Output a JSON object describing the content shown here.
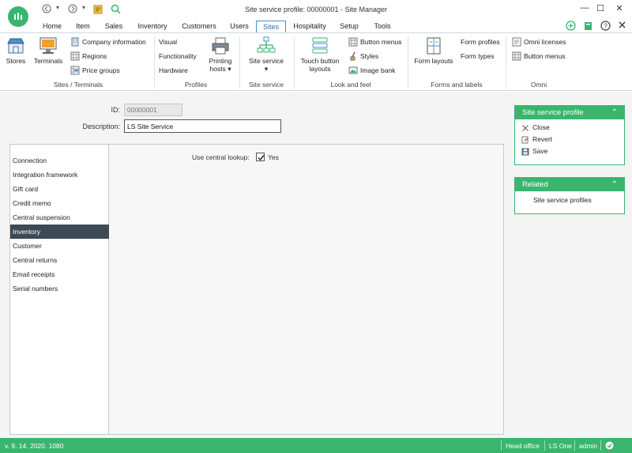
{
  "window": {
    "title": "Site service profile: 00000001 - Site Manager",
    "minimize": "—",
    "maximize": "☐",
    "close": "✕"
  },
  "quick_access": {
    "back": "◀",
    "dropdown": "▾",
    "forward": "▶",
    "dropdown2": "▾"
  },
  "tabs": [
    {
      "label": "Home"
    },
    {
      "label": "Item"
    },
    {
      "label": "Sales"
    },
    {
      "label": "Inventory"
    },
    {
      "label": "Customers"
    },
    {
      "label": "Users"
    },
    {
      "label": "Sites"
    },
    {
      "label": "Hospitality"
    },
    {
      "label": "Setup"
    },
    {
      "label": "Tools"
    }
  ],
  "active_tab": "Sites",
  "ribbon": {
    "sites_terminals": {
      "label": "Sites / Terminals",
      "stores": "Stores",
      "terminals": "Terminals",
      "company_information": "Company information",
      "regions": "Regions",
      "price_groups": "Price groups"
    },
    "profiles": {
      "label": "Profiles",
      "visual": "Visual",
      "functionality": "Functionality",
      "hardware": "Hardware",
      "printing_hosts_line1": "Printing",
      "printing_hosts_line2": "hosts",
      "dropdown": "▾"
    },
    "site_service": {
      "label": "Site service",
      "button": "Site service",
      "dropdown": "▾"
    },
    "look_and_feel": {
      "label": "Look and feel",
      "touch_line1": "Touch button",
      "touch_line2": "layouts",
      "button_menus": "Button menus",
      "styles": "Styles",
      "image_bank": "Image bank"
    },
    "forms_and_labels": {
      "label": "Forms and labels",
      "form_layouts": "Form layouts",
      "form_profiles": "Form profiles",
      "form_types": "Form types"
    },
    "omni": {
      "label": "Omni",
      "omni_licenses": "Omni licenses",
      "button_menus": "Button menus"
    }
  },
  "form": {
    "id_label": "ID:",
    "id_value": "00000001",
    "description_label": "Description:",
    "description_value": "LS Site Service"
  },
  "nav": {
    "items": [
      {
        "label": "Connection"
      },
      {
        "label": "Integration framework"
      },
      {
        "label": "Gift card"
      },
      {
        "label": "Credit  memo"
      },
      {
        "label": "Central suspension"
      },
      {
        "label": "Inventory"
      },
      {
        "label": "Customer"
      },
      {
        "label": "Central returns"
      },
      {
        "label": "Email receipts"
      },
      {
        "label": "Serial numbers"
      }
    ],
    "active": "Inventory"
  },
  "inventory_page": {
    "central_lookup_label": "Use central lookup:",
    "central_lookup_checked": true,
    "central_lookup_value": "Yes"
  },
  "actions_card": {
    "title": "Site service profile",
    "chevron": "⌃",
    "close": "Close",
    "revert": "Revert",
    "save": "Save"
  },
  "related_card": {
    "title": "Related",
    "chevron": "⌃",
    "site_service_profiles": "Site service profiles"
  },
  "status": {
    "version": "v. 9. 14. 2020. 1080",
    "store": "Head office",
    "terminal": "LS One",
    "user": "admin"
  },
  "colors": {
    "accent": "#3ab56e",
    "active_nav": "#3b4a55",
    "tab_active": "#4a90c8"
  }
}
